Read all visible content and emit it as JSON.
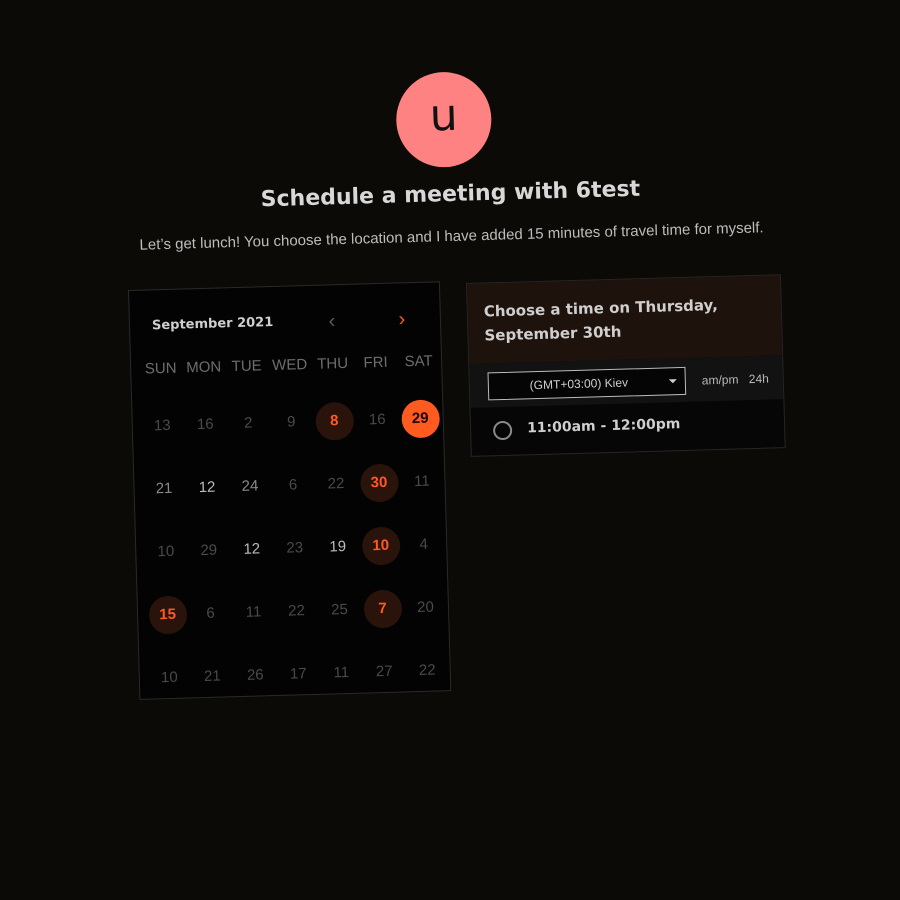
{
  "header": {
    "avatar_letter": "u",
    "title": "Schedule a meeting with 6test",
    "subtitle": "Let’s get lunch! You choose the location and I have added 15 minutes of travel time for myself."
  },
  "calendar": {
    "month_label": "September 2021",
    "prev_label": "‹",
    "next_label": "›",
    "weekdays": [
      "SUN",
      "MON",
      "TUE",
      "WED",
      "THU",
      "FRI",
      "SAT"
    ],
    "days": [
      {
        "label": "13",
        "state": "dim"
      },
      {
        "label": "16",
        "state": "dim"
      },
      {
        "label": "2",
        "state": "dim"
      },
      {
        "label": "9",
        "state": "dim"
      },
      {
        "label": "8",
        "state": "available"
      },
      {
        "label": "16",
        "state": "dim"
      },
      {
        "label": "29",
        "state": "selected"
      },
      {
        "label": "21",
        "state": "mid"
      },
      {
        "label": "12",
        "state": "bright"
      },
      {
        "label": "24",
        "state": "mid"
      },
      {
        "label": "6",
        "state": "dim"
      },
      {
        "label": "22",
        "state": "dim"
      },
      {
        "label": "30",
        "state": "available"
      },
      {
        "label": "11",
        "state": "dim"
      },
      {
        "label": "10",
        "state": "dim"
      },
      {
        "label": "29",
        "state": "dim"
      },
      {
        "label": "12",
        "state": "bright"
      },
      {
        "label": "23",
        "state": "dim"
      },
      {
        "label": "19",
        "state": "bright"
      },
      {
        "label": "10",
        "state": "available"
      },
      {
        "label": "4",
        "state": "dim"
      },
      {
        "label": "15",
        "state": "available"
      },
      {
        "label": "6",
        "state": "dim"
      },
      {
        "label": "11",
        "state": "dim"
      },
      {
        "label": "22",
        "state": "dim"
      },
      {
        "label": "25",
        "state": "dim"
      },
      {
        "label": "7",
        "state": "available"
      },
      {
        "label": "20",
        "state": "dim"
      },
      {
        "label": "10",
        "state": "dim"
      },
      {
        "label": "21",
        "state": "dim"
      },
      {
        "label": "26",
        "state": "dim"
      },
      {
        "label": "17",
        "state": "dim"
      },
      {
        "label": "11",
        "state": "dim"
      },
      {
        "label": "27",
        "state": "dim"
      },
      {
        "label": "22",
        "state": "dim"
      }
    ]
  },
  "time_panel": {
    "title": "Choose a time on Thursday, September 30th",
    "timezone_value": "(GMT+03:00) Kiev",
    "format_ampm": "am/pm",
    "format_24h": "24h",
    "slots": [
      "11:00am - 12:00pm"
    ]
  },
  "colors": {
    "accent": "#ff5a1f",
    "avatar_bg": "#ff8282",
    "background": "#0c0a07"
  }
}
